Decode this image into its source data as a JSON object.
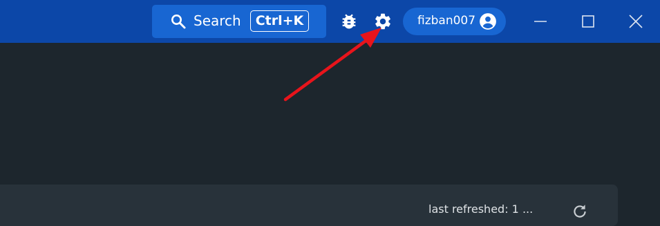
{
  "titlebar": {
    "search": {
      "label": "Search",
      "shortcut": "Ctrl+K",
      "icon": "search-icon"
    },
    "bug_icon": "bug-icon",
    "settings_icon": "gear-icon",
    "user": {
      "name": "fizban007",
      "icon": "account-circle-icon"
    },
    "window_controls": {
      "minimize_icon": "minimize-icon",
      "maximize_icon": "maximize-icon",
      "close_icon": "close-icon"
    }
  },
  "annotation": {
    "color": "#e8141b",
    "points_to": "gear-icon"
  },
  "card": {
    "text": "last refreshed: 1 ...",
    "refresh_icon": "refresh-icon"
  },
  "colors": {
    "titlebar": "#0c47a8",
    "accent": "#1866d2",
    "background": "#1d262d",
    "card": "#28323a"
  }
}
